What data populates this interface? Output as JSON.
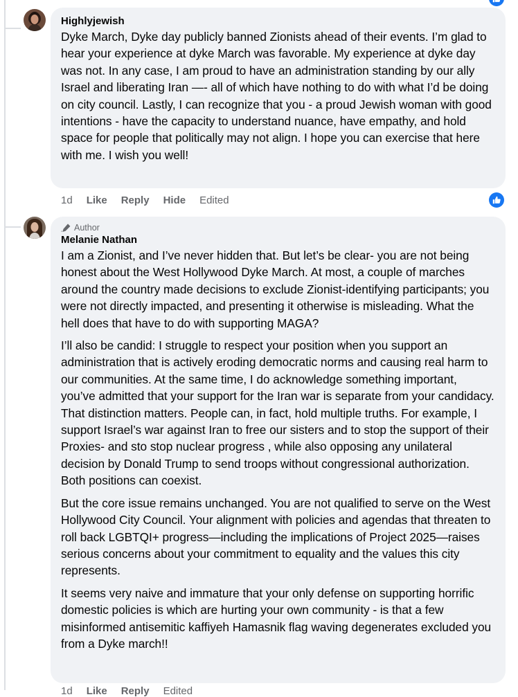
{
  "comment1": {
    "author": "Highlyjewish",
    "text": "Dyke March, Dyke day publicly banned Zionists ahead of their events. I’m glad to hear your experience at dyke March was favorable. My experience at dyke day was not. In any case, I am proud to have an administration standing by our ally Israel and liberating Iran —- all of which have nothing to do with what I’d be doing on city council. Lastly, I can recognize that you - a proud Jewish woman with good intentions - have the capacity to understand nuance, have empathy, and hold space for people that politically may not align. I hope you can exercise that here with me. I wish you well!",
    "actions": {
      "time": "1d",
      "like": "Like",
      "reply": "Reply",
      "hide": "Hide",
      "edited": "Edited"
    }
  },
  "comment2": {
    "author_tag": "Author",
    "author": "Melanie Nathan",
    "paragraphs": [
      "I am a Zionist, and I’ve never hidden that. But let’s be clear- you are not being honest about the West Hollywood Dyke March. At most, a couple of marches around the country made decisions to exclude Zionist-identifying participants; you were not directly impacted, and presenting it otherwise is misleading. What the hell does that have to do with supporting MAGA?",
      "I’ll also be candid: I struggle to respect your position when you support an administration that is actively eroding democratic norms and causing real harm to our communities. At the same time, I do acknowledge something important, you’ve admitted that your support for the Iran war is separate from your candidacy. That distinction matters. People can, in fact, hold multiple truths. For example, I support Israel’s war against Iran to free our sisters and to stop the support of their Proxies- and sto stop nuclear progress , while also opposing any unilateral decision by Donald Trump to send troops without congressional authorization. Both positions can coexist.",
      "But the core issue remains unchanged. You are not qualified to serve on the West Hollywood City Council. Your alignment with policies and agendas that threaten to roll back LGBTQI+ progress—including the implications of Project 2025—raises serious concerns about your commitment to equality and the values this city represents.",
      "It seems very naive and immature that your only defense on supporting horrific domestic policies is which are hurting your own community - is that a few misinformed antisemitic kaffiyeh Hamasnik flag waving degenerates excluded you from a Dyke march!!"
    ],
    "actions": {
      "time": "1d",
      "like": "Like",
      "reply": "Reply",
      "edited": "Edited"
    }
  },
  "colors": {
    "bubble": "#f0f2f5",
    "like_blue": "#1877f2",
    "meta_gray": "#65676b"
  }
}
